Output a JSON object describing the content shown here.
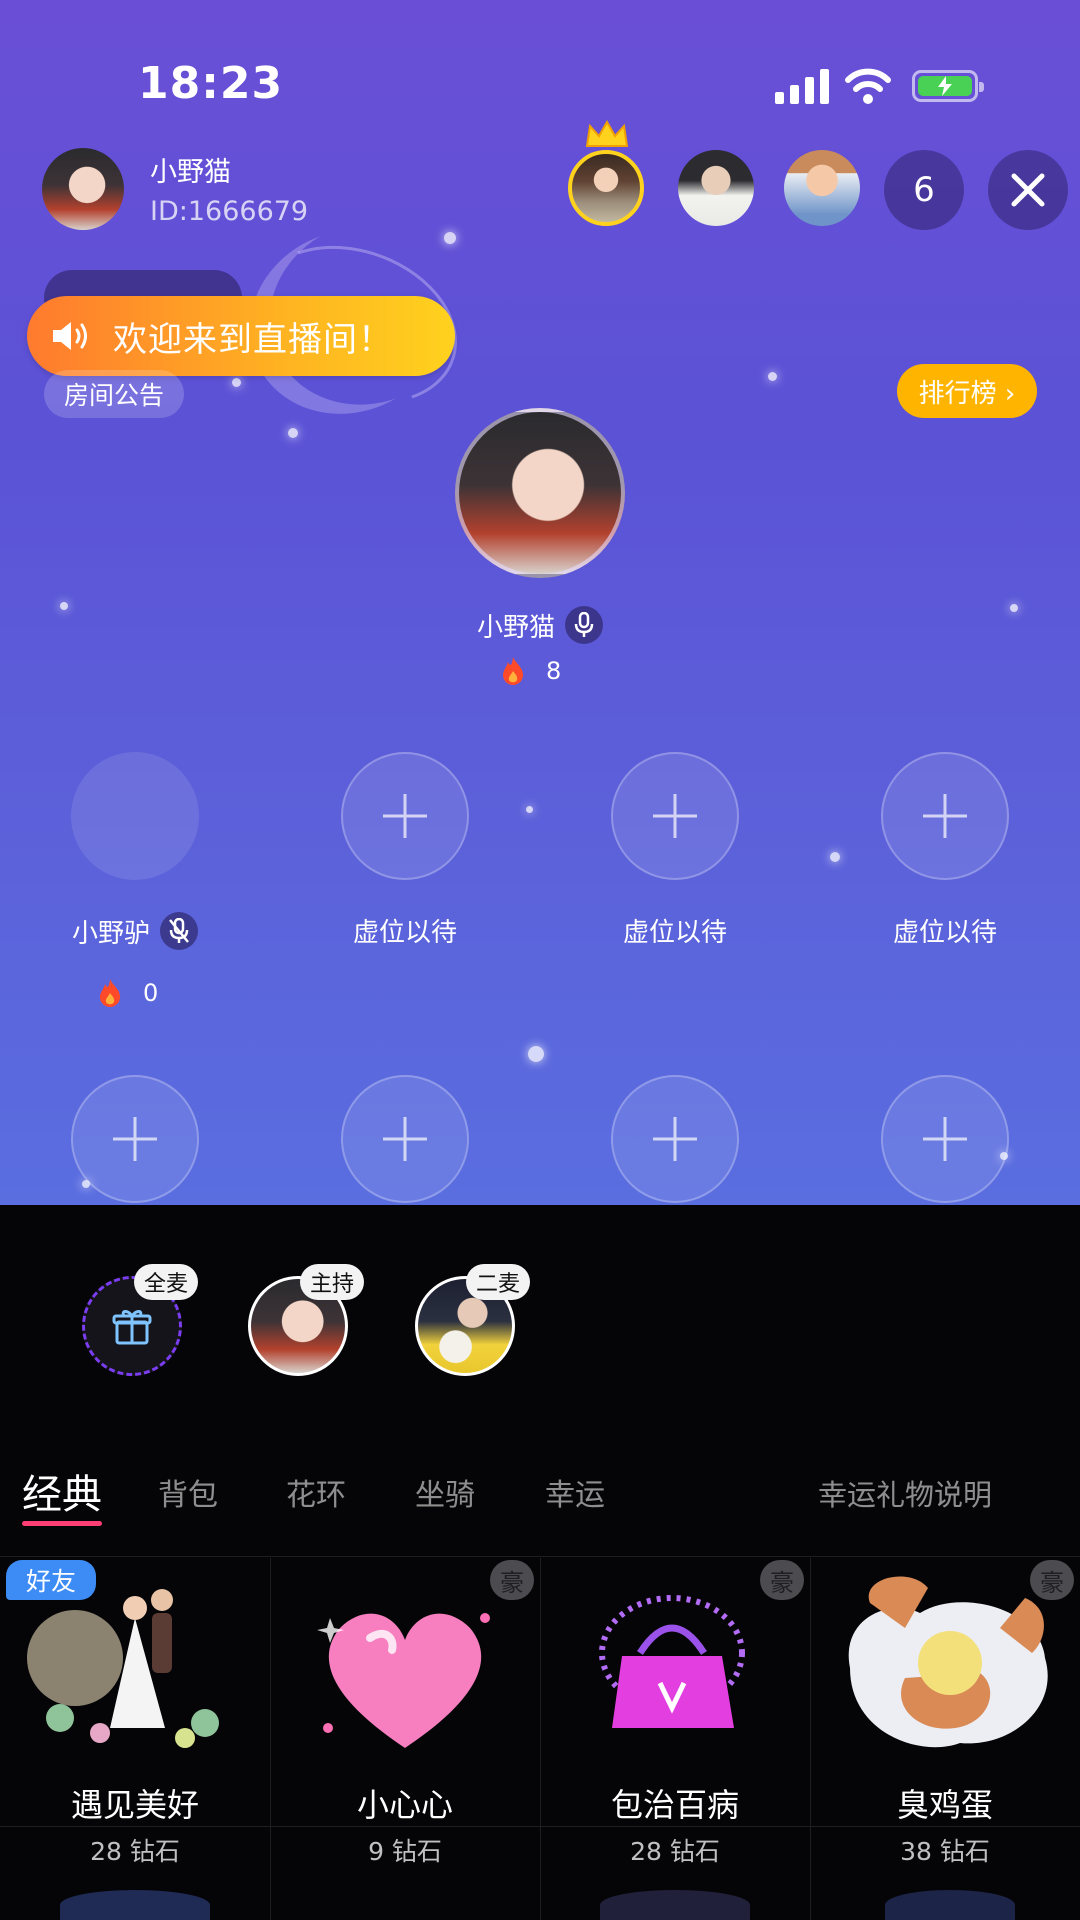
{
  "status_bar": {
    "time": "18:23"
  },
  "host": {
    "name": "小野猫",
    "id_text": "ID:1666679"
  },
  "viewers": {
    "count": "6"
  },
  "banner": {
    "welcome": "欢迎来到直播间！"
  },
  "room": {
    "notice_label": "房间公告",
    "ranking_label": "排行榜 ›"
  },
  "host_seat": {
    "name": "小野猫",
    "heat": "8"
  },
  "seats": [
    {
      "name": "小野驴",
      "heat": "0"
    },
    {
      "name": "虚位以待"
    },
    {
      "name": "虚位以待"
    },
    {
      "name": "虚位以待"
    }
  ],
  "recipients": [
    {
      "tag": "全麦"
    },
    {
      "tag": "主持"
    },
    {
      "tag": "二麦"
    }
  ],
  "tabs": [
    "经典",
    "背包",
    "花环",
    "坐骑",
    "幸运"
  ],
  "lucky_gift_link": "幸运礼物说明",
  "gift_badges": {
    "friend": "好友",
    "luxury": "豪"
  },
  "gifts": [
    {
      "name": "遇见美好",
      "price": "28 钻石"
    },
    {
      "name": "小心心",
      "price": "9 钻石"
    },
    {
      "name": "包治百病",
      "price": "28 钻石"
    },
    {
      "name": "臭鸡蛋",
      "price": "38 钻石"
    }
  ],
  "colors": {
    "accent": "#ff3f73",
    "rank": "#ffb400",
    "friend_tag": "#3d8bf5",
    "room_bg": "#5b52d6"
  }
}
